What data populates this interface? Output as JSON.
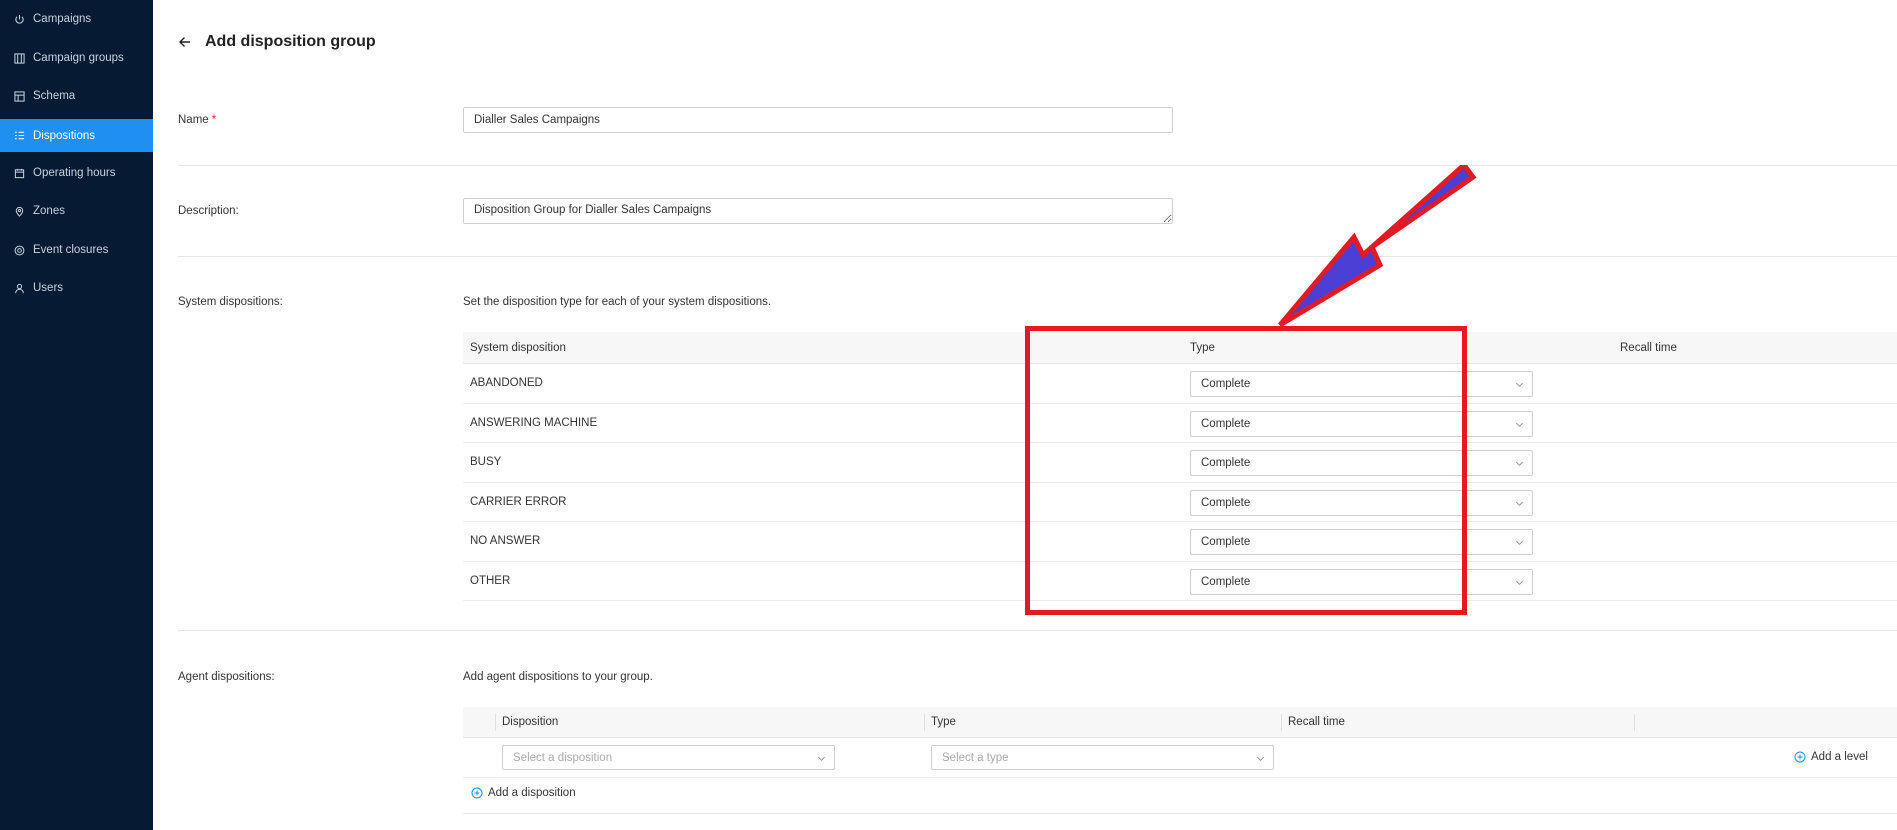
{
  "sidebar": {
    "items": [
      {
        "label": "Campaigns",
        "icon": "power-icon"
      },
      {
        "label": "Campaign groups",
        "icon": "campaign-groups-icon"
      },
      {
        "label": "Schema",
        "icon": "schema-icon"
      },
      {
        "label": "Dispositions",
        "icon": "list-icon",
        "active": true
      },
      {
        "label": "Operating hours",
        "icon": "calendar-icon"
      },
      {
        "label": "Zones",
        "icon": "location-pin-icon"
      },
      {
        "label": "Event closures",
        "icon": "target-icon"
      },
      {
        "label": "Users",
        "icon": "user-icon"
      }
    ],
    "active_color": "#1f8ff0",
    "bg_color": "#061a33"
  },
  "header": {
    "title": "Add disposition group"
  },
  "form": {
    "name_label": "Name",
    "required_mark": "*",
    "name_value": "Dialler Sales Campaigns",
    "description_label": "Description:",
    "description_value": "Disposition Group for Dialler Sales Campaigns",
    "system_label": "System dispositions:",
    "system_hint": "Set the disposition type for each of your system dispositions.",
    "agent_label": "Agent dispositions:",
    "agent_hint": "Add agent dispositions to your group."
  },
  "system_table": {
    "headers": {
      "disposition": "System disposition",
      "type": "Type",
      "recall": "Recall time"
    },
    "rows": [
      {
        "name": "ABANDONED",
        "type": "Complete"
      },
      {
        "name": "ANSWERING MACHINE",
        "type": "Complete"
      },
      {
        "name": "BUSY",
        "type": "Complete"
      },
      {
        "name": "CARRIER ERROR",
        "type": "Complete"
      },
      {
        "name": "NO ANSWER",
        "type": "Complete"
      },
      {
        "name": "OTHER",
        "type": "Complete"
      }
    ]
  },
  "agent_table": {
    "headers": {
      "disposition": "Disposition",
      "type": "Type",
      "recall": "Recall time"
    },
    "disposition_placeholder": "Select a disposition",
    "type_placeholder": "Select a type",
    "add_level": "Add a level",
    "add_disposition": "Add a disposition"
  },
  "annotation": {
    "box_color": "#e01b24",
    "arrow_fill": "#4b3fd6",
    "arrow_stroke": "#e01b24"
  }
}
